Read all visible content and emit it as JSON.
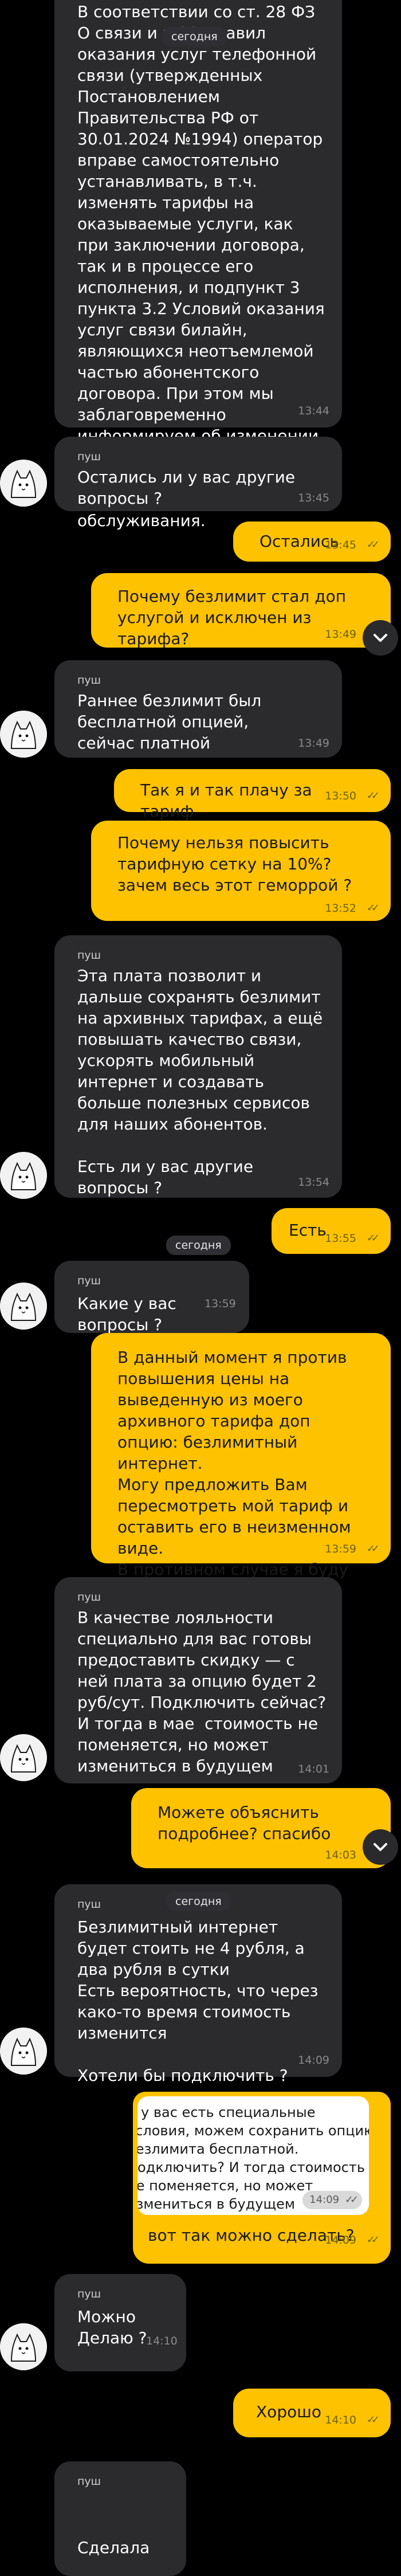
{
  "chat": {
    "date_label": "сегодня",
    "sender": "пуш",
    "messages": [
      {
        "id": "m1",
        "dir": "in",
        "text": "В соответствии со ст. 28 ФЗ О связи и п.30 Правил оказания услуг телефонной связи (утвержденных Постановлением Правительства РФ от 30.01.2024 №1994) оператор вправе самостоятельно устанавливать, в т.ч. изменять тарифы на оказываемые услуги, как при заключении договора, так и в процессе его исполнения, и подпункт 3 пункта 3.2 Условий оказания услуг связи билайн, являющихся неотъемлемой частью абонентского договора. При этом мы заблаговременно информируем об изменении условий, чтобы вы могли принять решение о дальнейших условиях обслуживания.",
        "time": "13:44"
      },
      {
        "id": "m2",
        "dir": "in",
        "text": "Остались ли у вас другие вопросы ?",
        "time": "13:45"
      },
      {
        "id": "m3",
        "dir": "out",
        "text": "Остались",
        "time": "13:45"
      },
      {
        "id": "m4",
        "dir": "out",
        "text": "Почему безлимит стал доп услугой и исключен из тарифа?",
        "time": "13:49"
      },
      {
        "id": "m5",
        "dir": "in",
        "text": "Раннее безлимит был бесплатной опцией, сейчас платной",
        "time": "13:49"
      },
      {
        "id": "m6",
        "dir": "out",
        "text": "Так я и так плачу за тариф",
        "time": "13:50"
      },
      {
        "id": "m7",
        "dir": "out",
        "text": "Почему нельзя повысить тарифную сетку на 10%? зачем весь этот геморрой ?",
        "time": "13:52"
      },
      {
        "id": "m8",
        "dir": "in",
        "text": "Эта плата позволит и дальше сохранять безлимит на архивных тарифах, а ещё повышать качество связи, ускорять мобильный интернет и создавать больше полезных сервисов для наших абонентов.\n\nЕсть ли у вас другие вопросы ?",
        "time": "13:54"
      },
      {
        "id": "m9",
        "dir": "out",
        "text": "Есть",
        "time": "13:55"
      },
      {
        "id": "m10",
        "dir": "in",
        "text": "Какие у вас вопросы ?",
        "time": "13:59"
      },
      {
        "id": "m11",
        "dir": "out",
        "text": "В данный момент я против повышения цены на выведенную из моего архивного тарифа доп опцию: безлимитный интернет.\nМогу предложить Вам пересмотреть мой тариф и оставить его в неизменном виде.\nВ противном случае я буду вынужден разорвать договор с Билайн.",
        "time": "13:59"
      },
      {
        "id": "m12",
        "dir": "in",
        "text": "В качестве лояльности специально для вас готовы предоставить скидку — с ней плата за опцию будет 2 руб/сут. Подключить сейчас? И тогда в мае  стоимость не поменяется, но может измениться в будущем",
        "time": "14:01"
      },
      {
        "id": "m13",
        "dir": "out",
        "text": "Можете объяснить подробнее? спасибо",
        "time": "14:03"
      },
      {
        "id": "m14",
        "dir": "in",
        "text": "Безлимитный интернет будет стоить не 4 рубля, а два рубля в сутки\nЕсть вероятность, что через како-то время стоимость изменится\n\nХотели бы подключить ?",
        "time": "14:09"
      },
      {
        "id": "m15",
        "dir": "out",
        "text": "вот так можно сделать?",
        "time": "14:09",
        "quote": {
          "text": "А у вас есть специальные условия, можем сохранить опцию безлимита бесплатной. Подключить? И тогда стоимость не поменяется, но может измениться в будущем",
          "time": "14:09"
        }
      },
      {
        "id": "m16",
        "dir": "in",
        "text": "Можно\nДелаю ?",
        "time": "14:10"
      },
      {
        "id": "m17",
        "dir": "out",
        "text": "Хорошо",
        "time": "14:10"
      },
      {
        "id": "m18",
        "dir": "in",
        "text": "Сделала",
        "time": ""
      }
    ]
  },
  "colors": {
    "incoming_bubble": "#2b2b2e",
    "outgoing_bubble": "#ffc200",
    "background": "#000000"
  },
  "icons": {
    "avatar": "white-cat-avatar",
    "read_receipt": "double-check-icon",
    "scroll_down": "chevron-down-icon"
  }
}
